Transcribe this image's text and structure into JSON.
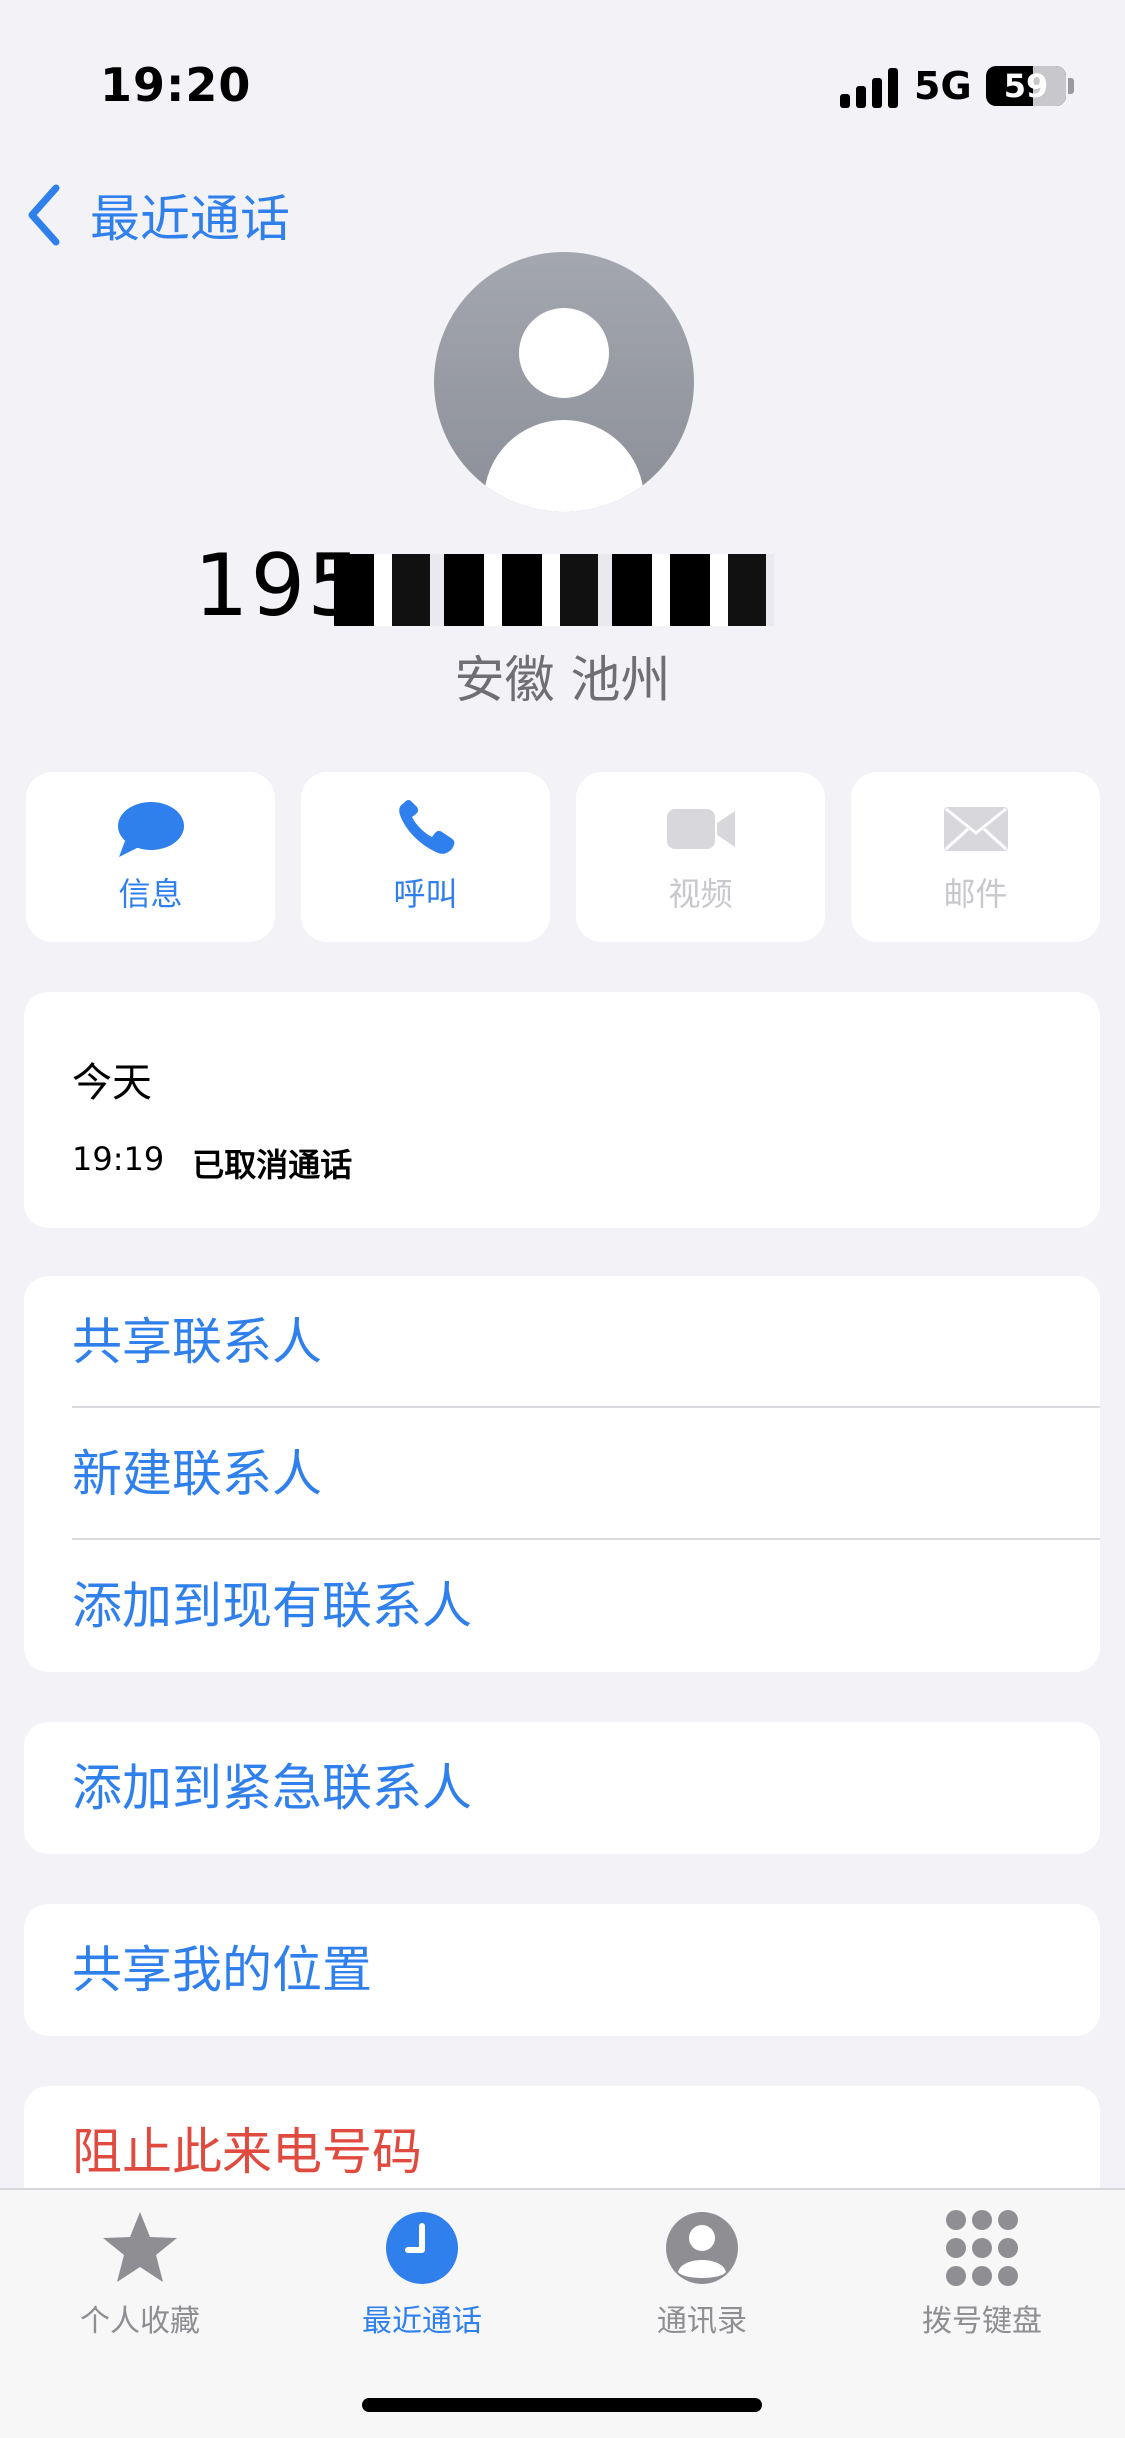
{
  "status_bar": {
    "time": "19:20",
    "network": "5G",
    "battery": "59",
    "battery_level": 0.59
  },
  "nav": {
    "back_label": "最近通话"
  },
  "contact": {
    "number_visible": "195",
    "location": "安徽 池州"
  },
  "actions": [
    {
      "label": "信息",
      "icon": "message-icon",
      "enabled": true
    },
    {
      "label": "呼叫",
      "icon": "phone-icon",
      "enabled": true
    },
    {
      "label": "视频",
      "icon": "video-icon",
      "enabled": false
    },
    {
      "label": "邮件",
      "icon": "mail-icon",
      "enabled": false
    }
  ],
  "recents": {
    "day": "今天",
    "time": "19:19",
    "status": "已取消通话"
  },
  "options": {
    "share_contact": "共享联系人",
    "new_contact": "新建联系人",
    "add_existing": "添加到现有联系人",
    "add_emergency": "添加到紧急联系人",
    "share_location": "共享我的位置",
    "block": "阻止此来电号码"
  },
  "tabs": [
    {
      "label": "个人收藏",
      "icon": "star-icon",
      "active": false
    },
    {
      "label": "最近通话",
      "icon": "clock-icon",
      "active": true
    },
    {
      "label": "通讯录",
      "icon": "person-circle-icon",
      "active": false
    },
    {
      "label": "拨号键盘",
      "icon": "keypad-icon",
      "active": false
    }
  ],
  "colors": {
    "accent": "#2f80ed",
    "danger": "#e04a3f",
    "background": "#f2f2f7",
    "disabled": "#c7c7cc"
  }
}
